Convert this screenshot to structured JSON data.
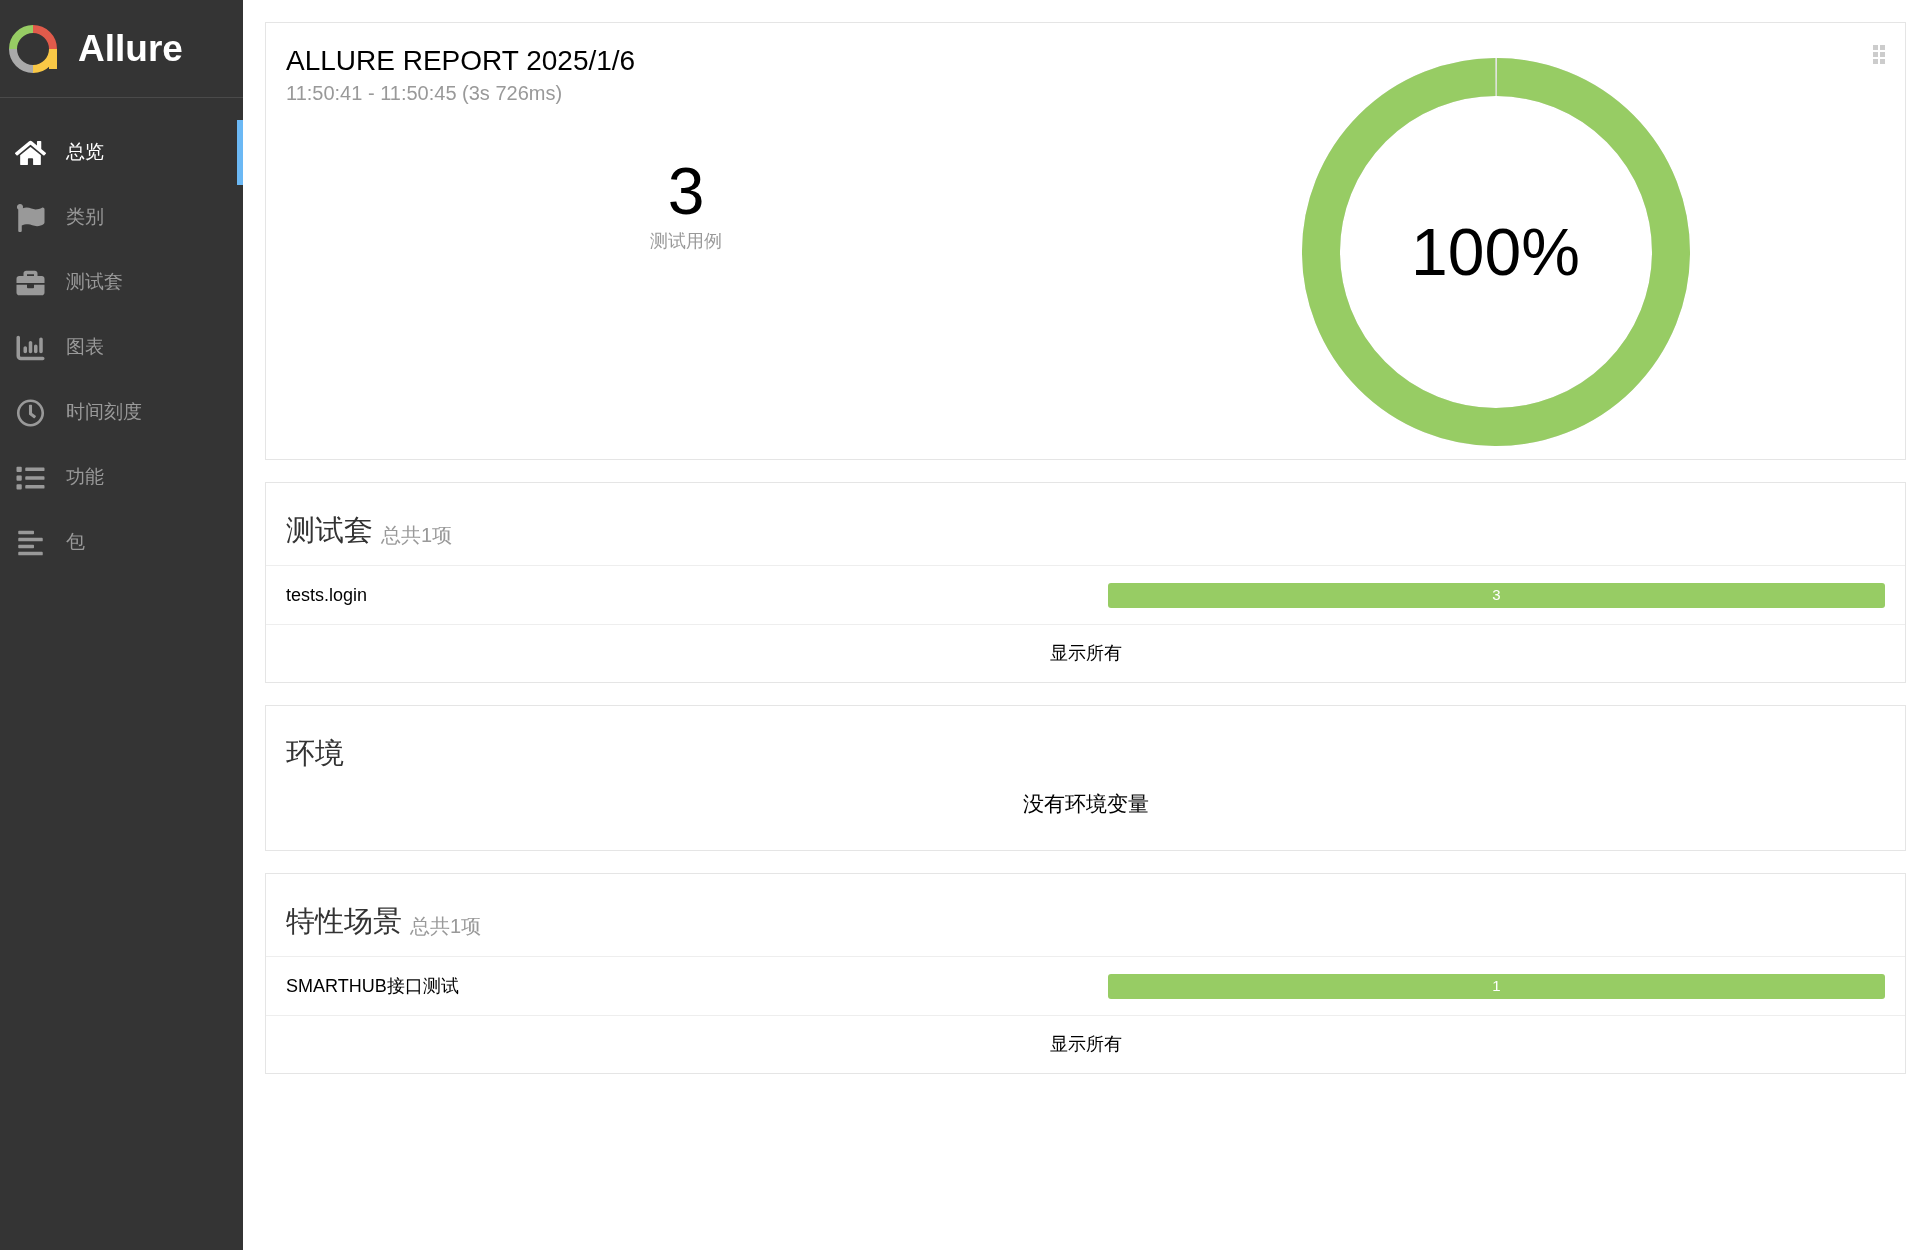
{
  "sidebar": {
    "logo": "Allure",
    "items": [
      {
        "label": "总览",
        "selected": true
      },
      {
        "label": "类别",
        "selected": false
      },
      {
        "label": "测试套",
        "selected": false
      },
      {
        "label": "图表",
        "selected": false
      },
      {
        "label": "时间刻度",
        "selected": false
      },
      {
        "label": "功能",
        "selected": false
      },
      {
        "label": "包",
        "selected": false
      }
    ]
  },
  "summary": {
    "title": "ALLURE REPORT 2025/1/6",
    "time": "11:50:41 - 11:50:45 (3s 726ms)",
    "count": "3",
    "count_label": "测试用例",
    "percent": "100%",
    "level": 1
  },
  "widgets": [
    {
      "kind": "bars",
      "title": "测试套",
      "total": "总共1项",
      "rows": [
        {
          "name": "tests.login",
          "count": "3",
          "level": 1
        }
      ],
      "show_all": "显示所有"
    },
    {
      "kind": "empty",
      "title": "环境",
      "message": "没有环境变量"
    },
    {
      "kind": "bars",
      "title": "特性场景",
      "total": "总共1项",
      "rows": [
        {
          "name": "SMARTHUB接口测试",
          "count": "1",
          "level": 1
        }
      ],
      "show_all": "显示所有"
    }
  ]
}
